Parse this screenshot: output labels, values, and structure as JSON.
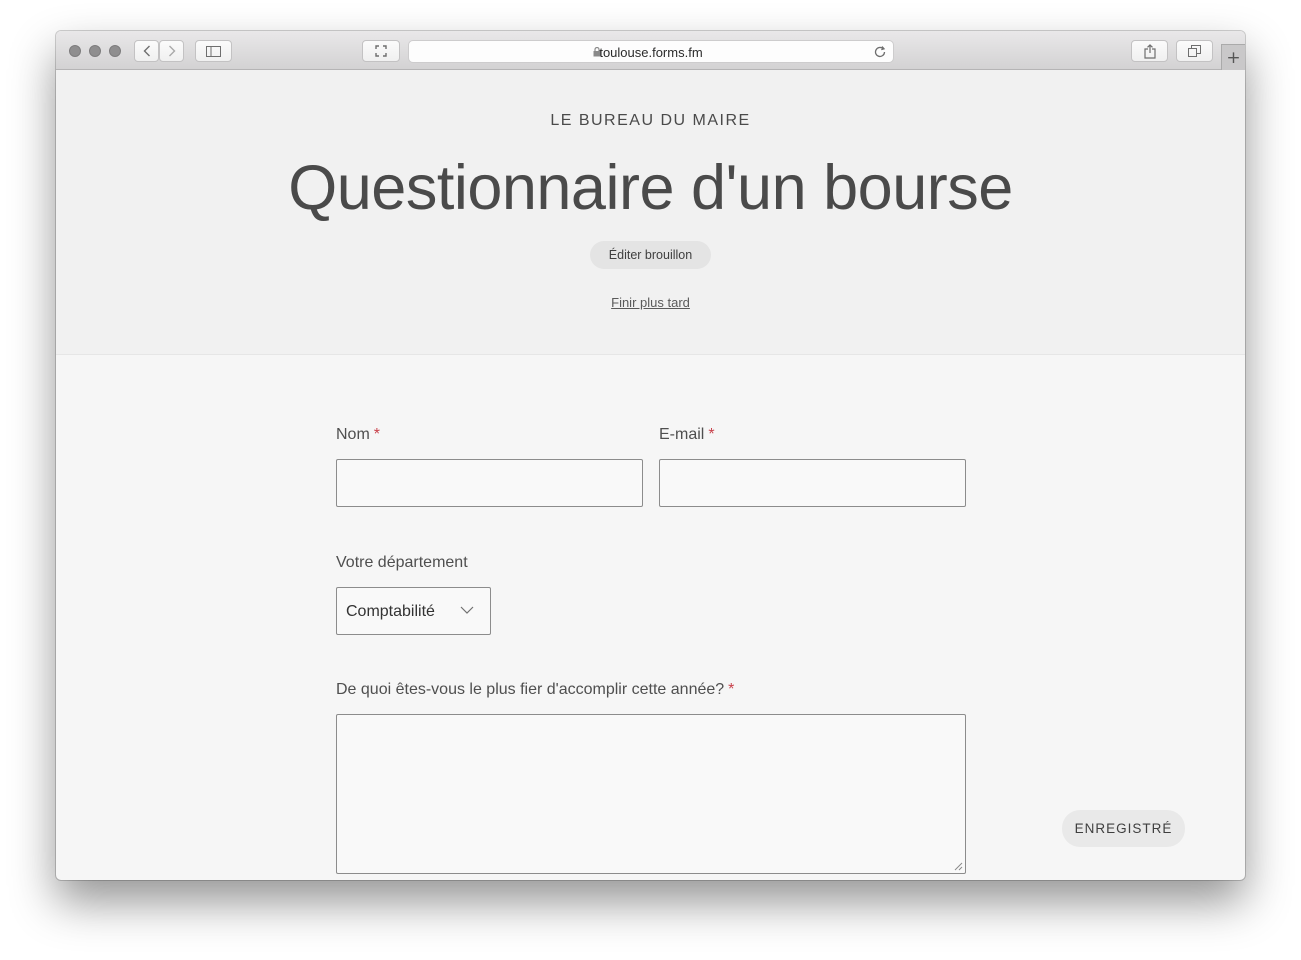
{
  "browser": {
    "url": "toulouse.forms.fm",
    "icons": [
      "back-icon",
      "forward-icon",
      "sidebar-icon",
      "fullscreen-icon",
      "lock-icon",
      "reload-icon",
      "share-icon",
      "tabs-icon",
      "new-tab-icon"
    ]
  },
  "header": {
    "organization": "LE BUREAU DU MAIRE",
    "title": "Questionnaire d'un bourse",
    "draft_button": "Éditer brouillon",
    "finish_later_link": "Finir plus tard"
  },
  "form": {
    "name_label": "Nom",
    "email_label": "E-mail",
    "required_marker": "*",
    "name_value": "",
    "email_value": "",
    "department_label": "Votre département",
    "department_selected": "Comptabilité",
    "proud_label": "De quoi êtes-vous le plus fier d'accomplir cette année?",
    "proud_value": ""
  },
  "status": {
    "saved_label": "ENREGISTRÉ"
  },
  "colors": {
    "required": "#c8404a",
    "text": "#4a4a4a",
    "header_bg": "#f1f1f1",
    "body_bg": "#f6f6f6"
  }
}
